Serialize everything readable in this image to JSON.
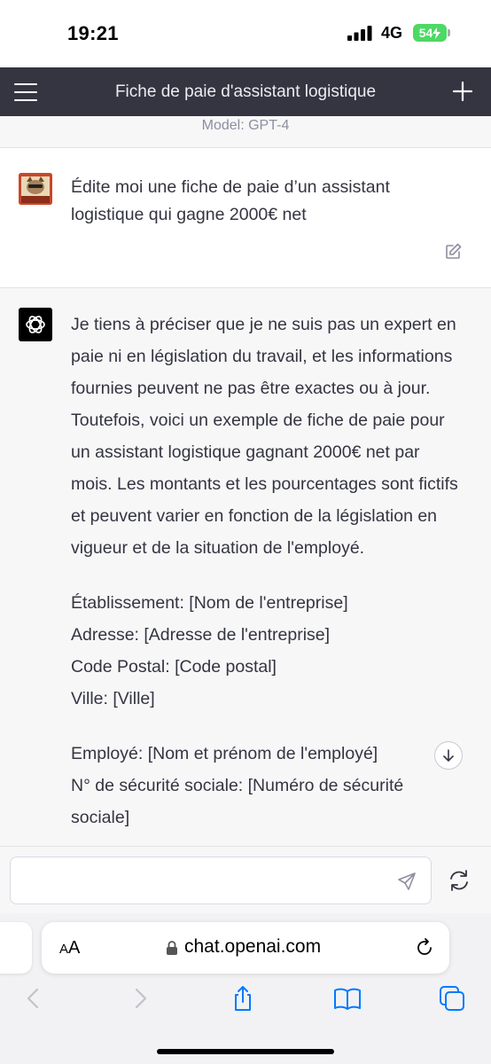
{
  "status": {
    "time": "19:21",
    "network": "4G",
    "battery": "54"
  },
  "nav": {
    "title": "Fiche de paie d'assistant logistique"
  },
  "model_label": "Model: GPT-4",
  "user_message": {
    "text": "Édite moi une fiche de paie d’un assistant logistique qui gagne 2000€ net"
  },
  "assistant_message": {
    "intro": "Je tiens à préciser que je ne suis pas un expert en paie ni en législation du travail, et les informations fournies peuvent ne pas être exactes ou à jour. Toutefois, voici un exemple de fiche de paie pour un assistant logistique gagnant 2000€ net par mois. Les montants et les pourcentages sont fictifs et peuvent varier en fonction de la législation en vigueur et de la situation de l'employé.",
    "company_lines": [
      "Établissement: [Nom de l'entreprise]",
      "Adresse: [Adresse de l'entreprise]",
      "Code Postal: [Code postal]",
      "Ville: [Ville]"
    ],
    "employee_lines": [
      "Employé: [Nom et prénom de l'employé]",
      "N° de sécurité sociale: [Numéro de sécurité sociale]"
    ]
  },
  "input": {
    "value": "",
    "placeholder": ""
  },
  "browser": {
    "aa_small": "A",
    "aa_large": "A",
    "url": "chat.openai.com"
  },
  "icons": {
    "menu": "hamburger-icon",
    "new_chat": "plus-icon",
    "edit": "edit-icon",
    "bot": "openai-logo-icon",
    "scroll": "arrow-down-icon",
    "send": "send-icon",
    "regenerate": "refresh-icon",
    "lock": "lock-icon",
    "reload": "reload-icon",
    "back": "chevron-left-icon",
    "forward": "chevron-right-icon",
    "share": "share-icon",
    "bookmarks": "book-icon",
    "tabs": "tabs-icon"
  },
  "colors": {
    "nav_bg": "#343541",
    "battery": "#4cd964",
    "safari_blue": "#007aff"
  }
}
